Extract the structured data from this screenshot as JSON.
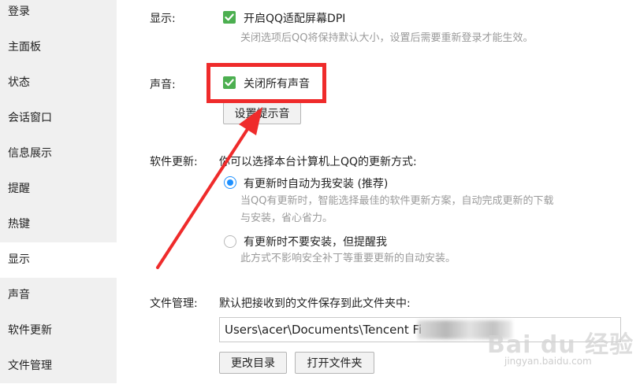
{
  "sidebar": {
    "items": [
      {
        "label": "登录"
      },
      {
        "label": "主面板"
      },
      {
        "label": "状态"
      },
      {
        "label": "会话窗口"
      },
      {
        "label": "信息展示"
      },
      {
        "label": "提醒"
      },
      {
        "label": "热键"
      },
      {
        "label": "显示",
        "active": true
      },
      {
        "label": "声音"
      },
      {
        "label": "软件更新"
      },
      {
        "label": "文件管理"
      }
    ]
  },
  "display_section": {
    "label": "显示:",
    "checkbox_label": "开启QQ适配屏幕DPI",
    "checked": true,
    "description": "关闭选项后QQ将保持默认大小，设置后需要重新登录才能生效。"
  },
  "sound_section": {
    "label": "声音:",
    "checkbox_label": "关闭所有声音",
    "checked": true,
    "button_label": "设置提示音"
  },
  "update_section": {
    "label": "软件更新:",
    "intro": "你可以选择本台计算机上QQ的更新方式:",
    "options": [
      {
        "label": "有更新时自动为我安装 (推荐)",
        "selected": true,
        "description_lines": [
          "当QQ有更新时，智能选择最佳的软件更新方案，自动完成更新的下载",
          "与安装，省心省力。"
        ]
      },
      {
        "label": "有更新时不要安装，但提醒我",
        "selected": false,
        "description_lines": [
          "此方式不影响安全补丁等重要更新的自动安装。"
        ]
      }
    ]
  },
  "file_section": {
    "label": "文件管理:",
    "intro": "默认把接收到的文件保存到此文件夹中:",
    "path_value": "Users\\acer\\Documents\\Tencent Fi",
    "change_button": "更改目录",
    "open_button": "打开文件夹"
  },
  "watermark": {
    "main": "Bai du 经验",
    "sub": "jingyan.baidu.com"
  },
  "colors": {
    "accent_green": "#4caf50",
    "radio_blue": "#1e90ff",
    "annotation_red": "#ef2b2b",
    "sidebar_bg": "#f0f0f0"
  }
}
